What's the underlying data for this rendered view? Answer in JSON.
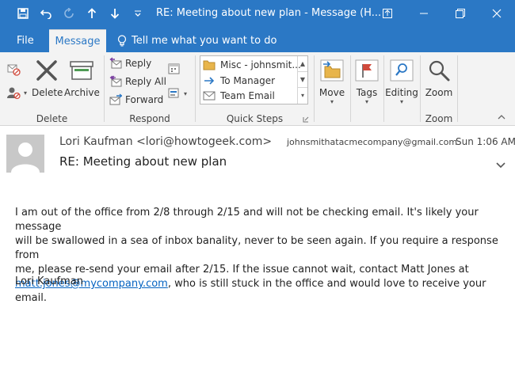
{
  "window": {
    "title": "RE: Meeting about new plan  -  Message (H..."
  },
  "tabs": {
    "file": "File",
    "message": "Message",
    "tell_me": "Tell me what you want to do"
  },
  "ribbon": {
    "delete_group": {
      "label": "Delete",
      "delete": "Delete",
      "archive": "Archive"
    },
    "respond_group": {
      "label": "Respond",
      "reply": "Reply",
      "reply_all": "Reply All",
      "forward": "Forward"
    },
    "quick_steps": {
      "label": "Quick Steps",
      "items": [
        "Misc - johnsmit...",
        "To Manager",
        "Team Email"
      ]
    },
    "move": "Move",
    "tags": "Tags",
    "editing": "Editing",
    "zoom_group": {
      "label": "Zoom",
      "zoom": "Zoom"
    }
  },
  "message": {
    "sender": "Lori Kaufman <lori@howtogeek.com>",
    "to": "johnsmithatacmecompany@gmail.com",
    "time": "Sun 1:06 AM",
    "subject": "RE: Meeting about new plan",
    "body": {
      "line1": "I am out of the office from 2/8 through 2/15 and will not be checking email. It's likely your message",
      "line2": "will be swallowed in a sea of inbox banality, never to be seen again. If you require a response from",
      "line3": "me, please re-send your email after 2/15. If the issue cannot wait, contact Matt Jones at",
      "link": "matt.jones@mycompany.com",
      "line4_rest": ", who is still stuck in the office and would love to receive your email."
    },
    "signature": "Lori Kaufman"
  },
  "colors": {
    "title_bar": "#2b78c5",
    "ribbon_bg": "#f3f3f3",
    "link": "#0563c1"
  }
}
